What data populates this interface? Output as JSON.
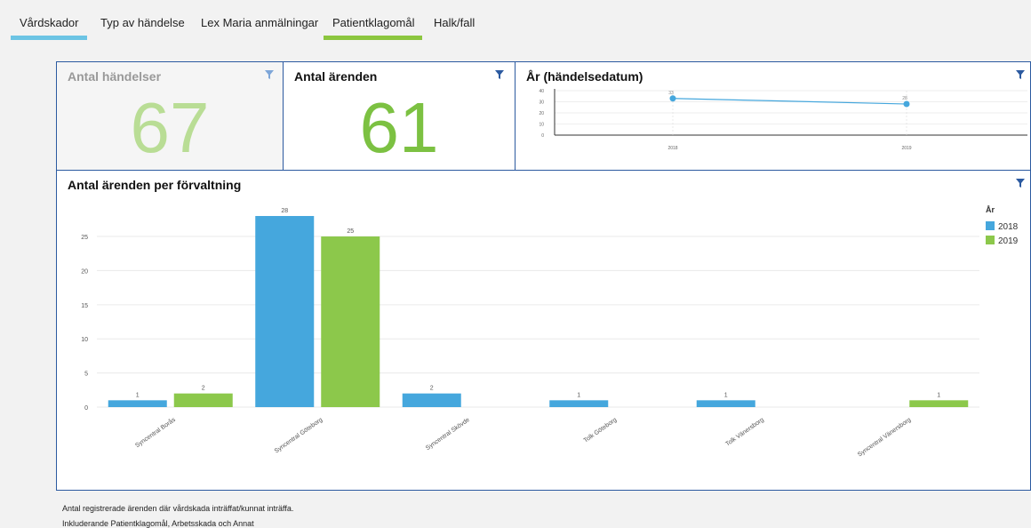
{
  "tabs": [
    {
      "label": "Vårdskador",
      "active": true,
      "underline_color": "#6cc4e4"
    },
    {
      "label": "Typ av händelse",
      "active": false
    },
    {
      "label": "Lex Maria anmälningar",
      "active": false
    },
    {
      "label": "Patientklagomål",
      "active": true,
      "underline_color": "#8cc63f"
    },
    {
      "label": "Halk/fall",
      "active": false
    }
  ],
  "kpi_events": {
    "title": "Antal händelser",
    "value": "67",
    "color": "#b9dd95",
    "icon": "filter-icon"
  },
  "kpi_cases": {
    "title": "Antal ärenden",
    "value": "61",
    "color": "#7cc142",
    "icon": "filter-icon"
  },
  "year_chart": {
    "title": "År (händelsedatum)",
    "icon": "filter-icon"
  },
  "bar_chart": {
    "title": "Antal ärenden per förvaltning",
    "icon": "filter-icon",
    "legend_title": "År"
  },
  "colors": {
    "series_2018": "#45a7dd",
    "series_2019": "#8cc84b",
    "accent_blue": "#2c5aa0"
  },
  "footer": {
    "line1": "Antal registrerade ärenden där vårdskada inträffat/kunnat inträffa.",
    "line2": "Inkluderande Patientklagomål, Arbetsskada och Annat"
  },
  "chart_data": [
    {
      "type": "line",
      "x": [
        "2018",
        "2019"
      ],
      "series": [
        {
          "name": "",
          "values": [
            33,
            28
          ]
        }
      ],
      "ylim": [
        0,
        40
      ],
      "yticks": [
        "0",
        "10",
        "20",
        "30",
        "40"
      ],
      "title": "År (händelsedatum)",
      "grid": true
    },
    {
      "type": "bar",
      "categories": [
        "Syncentral Borås",
        "Syncentral Göteborg",
        "Syncentral Skövde",
        "Tolk Göteborg",
        "Tolk Vänersborg",
        "Syncentral Vänersborg"
      ],
      "series": [
        {
          "name": "2018",
          "values": [
            1,
            28,
            2,
            1,
            1,
            null
          ]
        },
        {
          "name": "2019",
          "values": [
            2,
            25,
            null,
            null,
            null,
            1
          ]
        }
      ],
      "ylim": [
        0,
        28
      ],
      "yticks": [
        "0",
        "5",
        "10",
        "15",
        "20",
        "25"
      ],
      "title": "Antal ärenden per förvaltning",
      "legend_title": "År",
      "legend_position": "right",
      "grid": true
    }
  ]
}
